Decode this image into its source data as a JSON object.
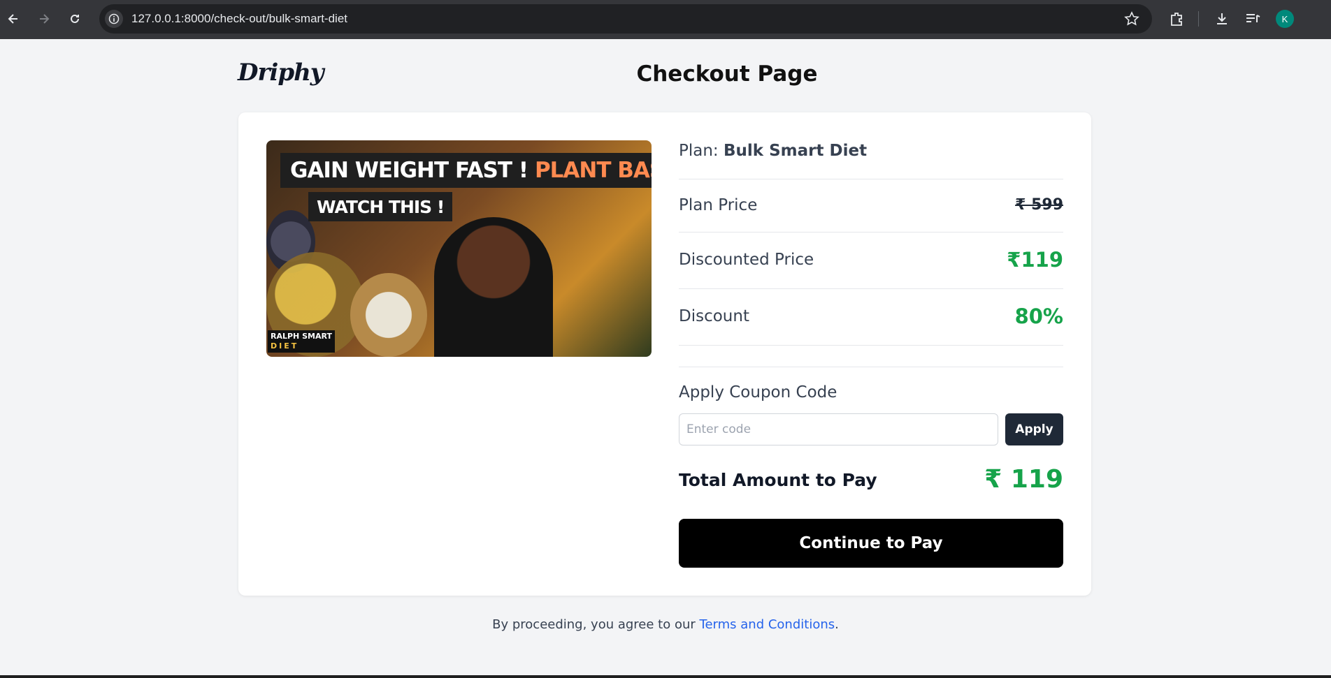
{
  "browser": {
    "url": "127.0.0.1:8000/check-out/bulk-smart-diet",
    "profile_initial": "K"
  },
  "header": {
    "logo": "Driphy",
    "title": "Checkout Page"
  },
  "product": {
    "thumbnail": {
      "line1": "GAIN WEIGHT FAST !",
      "line1_highlight": "PLANT BASED",
      "line2": "WATCH THIS !",
      "brand_line1": "RALPH SMART",
      "brand_line2": "DIET"
    },
    "plan_label": "Plan:",
    "plan_name": "Bulk Smart Diet"
  },
  "pricing": {
    "plan_price_label": "Plan Price",
    "plan_price": "₹ 599",
    "discounted_label": "Discounted Price",
    "discounted_price": "₹119",
    "discount_label": "Discount",
    "discount": "80%"
  },
  "coupon": {
    "label": "Apply Coupon Code",
    "placeholder": "Enter code",
    "button": "Apply"
  },
  "total": {
    "label": "Total Amount to Pay",
    "value": "₹ 119"
  },
  "pay_button": "Continue to Pay",
  "footer": {
    "text": "By proceeding, you agree to our ",
    "link": "Terms and Conditions",
    "end": "."
  },
  "colors": {
    "accent_green": "#16a34a",
    "dark_button": "#1f2937",
    "link_blue": "#2563eb"
  }
}
